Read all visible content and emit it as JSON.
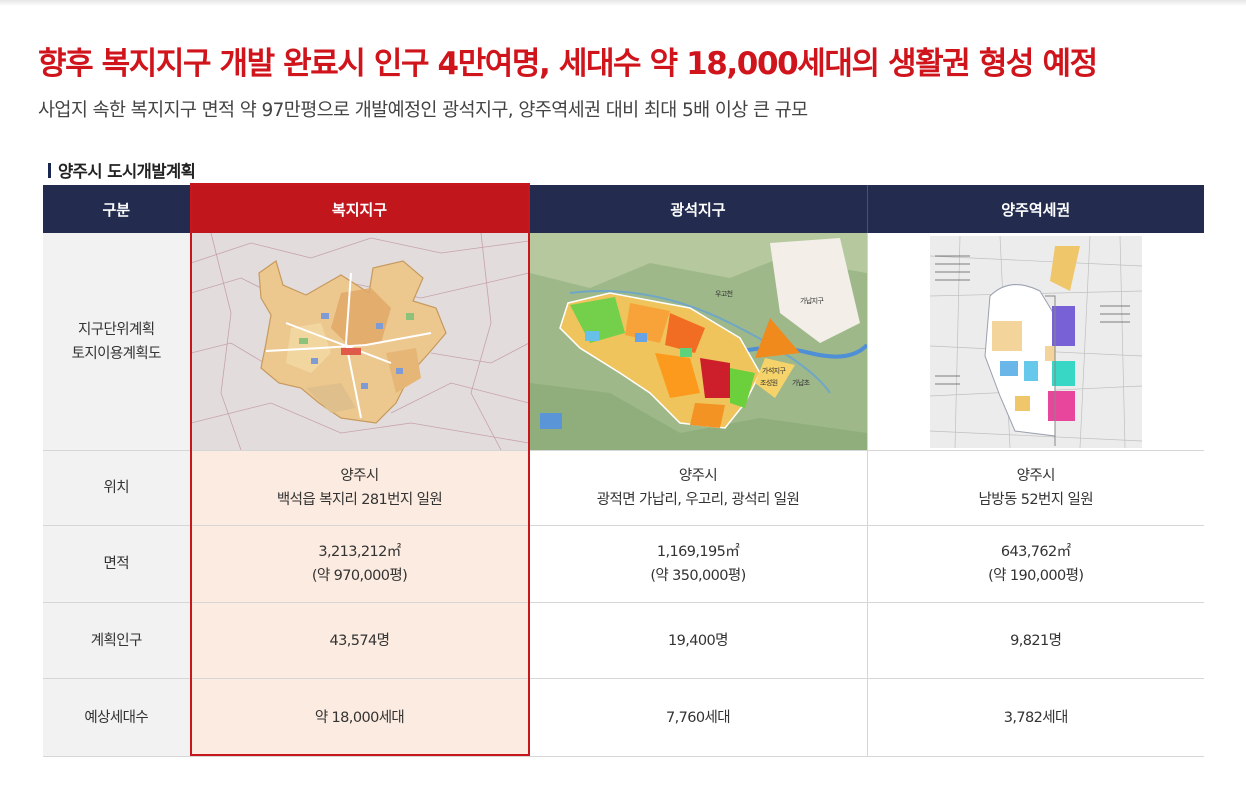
{
  "headline": "향후 복지지구 개발 완료시 인구 4만여명, 세대수 약 18,000세대의 생활권 형성 예정",
  "subline": "사업지 속한 복지지구 면적 약 97만평으로 개발예정인 광석지구, 양주역세권 대비 최대 5배 이상 큰 규모",
  "section_title": "양주시 도시개발계획",
  "table": {
    "headers": [
      "구분",
      "복지지구",
      "광석지구",
      "양주역세권"
    ],
    "row_labels": {
      "map": [
        "지구단위계획",
        "토지이용계획도"
      ],
      "location": "위치",
      "area": "면적",
      "population": "계획인구",
      "households": "예상세대수"
    },
    "location": [
      [
        "양주시",
        "백석읍 복지리 281번지 일원"
      ],
      [
        "양주시",
        "광적면 가납리, 우고리, 광석리 일원"
      ],
      [
        "양주시",
        "남방동 52번지 일원"
      ]
    ],
    "area": [
      [
        "3,213,212㎡",
        "(약 970,000평)"
      ],
      [
        "1,169,195㎡",
        "(약 350,000평)"
      ],
      [
        "643,762㎡",
        "(약 190,000평)"
      ]
    ],
    "population": [
      "43,574명",
      "19,400명",
      "9,821명"
    ],
    "households": [
      "약 18,000세대",
      "7,760세대",
      "3,782세대"
    ]
  },
  "map_labels": {
    "gwangseok": [
      "우고천",
      "가납지구",
      "가석지구",
      "조성원",
      "가납초"
    ]
  },
  "colors": {
    "headline": "#d0141c",
    "header_bg": "#232c4e",
    "highlight_header": "#c1161c",
    "highlight_cell": "#fcebe0",
    "label_bg": "#f2f2f2"
  }
}
